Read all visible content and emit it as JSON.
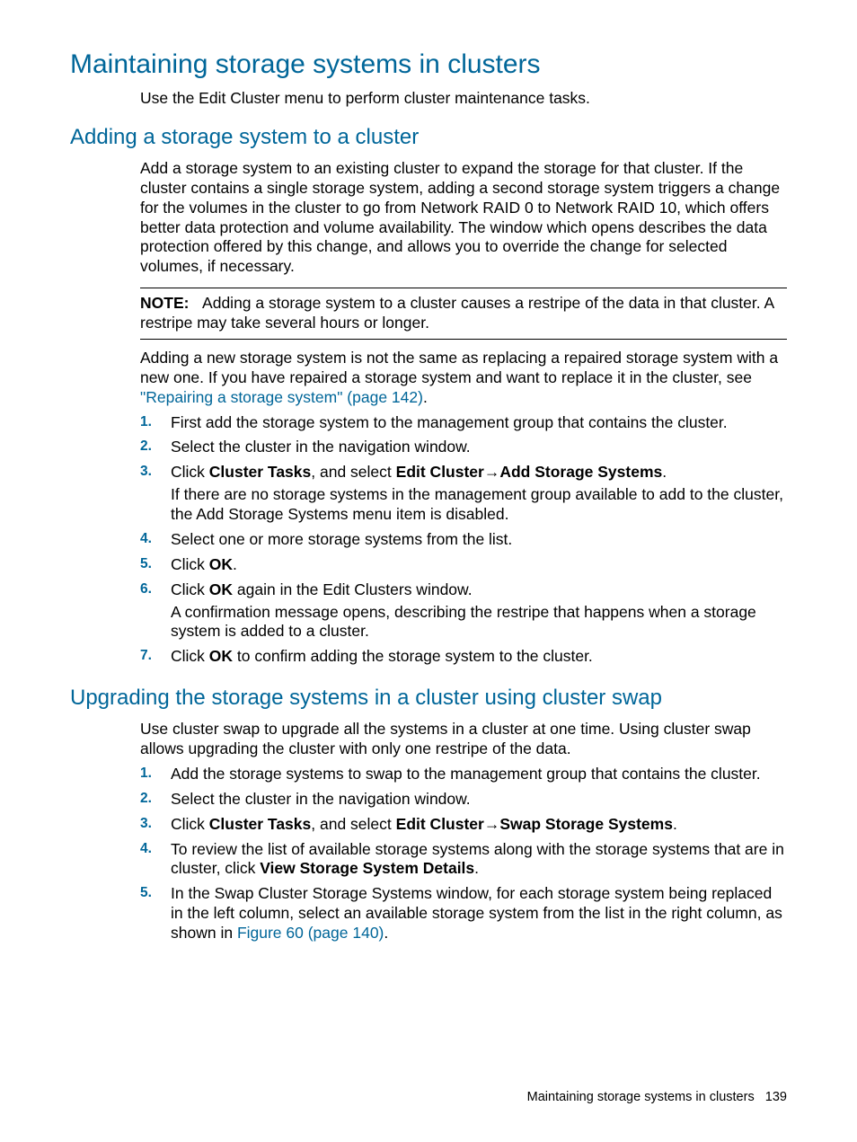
{
  "h1": "Maintaining storage systems in clusters",
  "intro": "Use the Edit Cluster menu to perform cluster maintenance tasks.",
  "s1": {
    "title": "Adding a storage system to a cluster",
    "p1": "Add a storage system to an existing cluster to expand the storage for that cluster. If the cluster contains a single storage system, adding a second storage system triggers a change for the volumes in the cluster to go from Network RAID 0 to Network RAID 10, which offers better data protection and volume availability. The window which opens describes the data protection offered by this change, and allows you to override the change for selected volumes, if necessary.",
    "note_label": "NOTE:",
    "note_body": "Adding a storage system to a cluster causes a restripe of the data in that cluster. A restripe may take several hours or longer.",
    "p2a": "Adding a new storage system is not the same as replacing a repaired storage system with a new one. If you have repaired a storage system and want to replace it in the cluster, see ",
    "p2link": "\"Repairing a storage system\" (page 142)",
    "p2b": ".",
    "steps": {
      "1": "First add the storage system to the management group that contains the cluster.",
      "2": "Select the cluster in the navigation window.",
      "3a": "Click ",
      "3b": "Cluster Tasks",
      "3c": ", and select ",
      "3d": "Edit Cluster",
      "3arrow": "→",
      "3e": "Add Storage Systems",
      "3f": ".",
      "3p2": "If there are no storage systems in the management group available to add to the cluster, the Add Storage Systems menu item is disabled.",
      "4": "Select one or more storage systems from the list.",
      "5a": "Click ",
      "5b": "OK",
      "5c": ".",
      "6a": "Click ",
      "6b": "OK",
      "6c": " again in the Edit Clusters window.",
      "6p2": "A confirmation message opens, describing the restripe that happens when a storage system is added to a cluster.",
      "7a": "Click ",
      "7b": "OK",
      "7c": " to confirm adding the storage system to the cluster."
    }
  },
  "s2": {
    "title": "Upgrading the storage systems in a cluster using cluster swap",
    "p1": "Use cluster swap to upgrade all the systems in a cluster at one time. Using cluster swap allows upgrading the cluster with only one restripe of the data.",
    "steps": {
      "1": "Add the storage systems to swap to the management group that contains the cluster.",
      "2": "Select the cluster in the navigation window.",
      "3a": "Click ",
      "3b": "Cluster Tasks",
      "3c": ", and select ",
      "3d": "Edit Cluster",
      "3arrow": "→",
      "3e": "Swap Storage Systems",
      "3f": ".",
      "4a": "To review the list of available storage systems along with the storage systems that are in cluster, click ",
      "4b": "View Storage System Details",
      "4c": ".",
      "5a": "In the Swap Cluster Storage Systems window, for each storage system being replaced in the left column, select an available storage system from the list in the right column, as shown in ",
      "5link": "Figure 60 (page 140)",
      "5b": "."
    }
  },
  "footer": {
    "text": "Maintaining storage systems in clusters",
    "page": "139"
  },
  "nums": [
    "1.",
    "2.",
    "3.",
    "4.",
    "5.",
    "6.",
    "7."
  ]
}
